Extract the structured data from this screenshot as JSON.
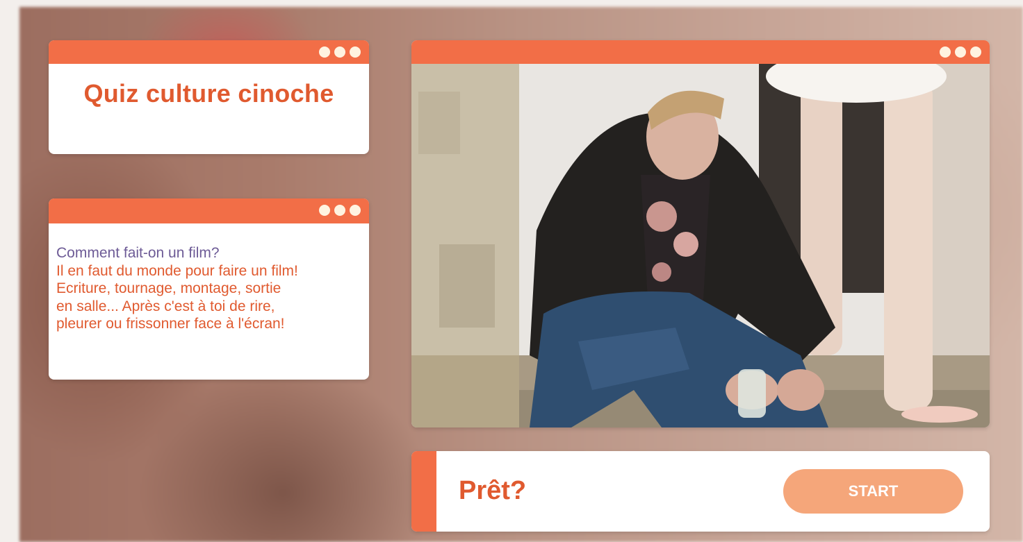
{
  "title_card": {
    "title": "Quiz culture cinoche"
  },
  "info_card": {
    "heading": "Comment fait-on un film?",
    "lines": [
      "Il en faut du monde pour faire un film!",
      "Ecriture, tournage, montage, sortie",
      "en salle... Après c'est à toi de rire,",
      "pleurer ou frissonner face à l'écran!"
    ]
  },
  "ready_bar": {
    "label": "Prêt?",
    "start_label": "START"
  },
  "colors": {
    "accent": "#f26e47",
    "title_text": "#e05a2f",
    "heading_text": "#6d5b96",
    "start_button": "#f5a67a"
  }
}
